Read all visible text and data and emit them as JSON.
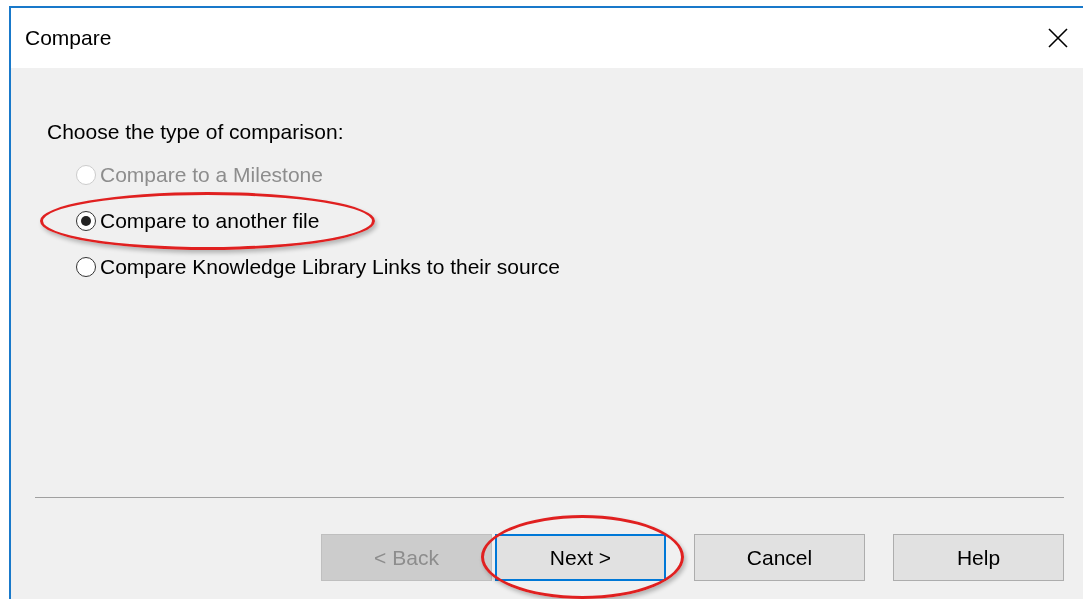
{
  "window": {
    "title": "Compare"
  },
  "prompt": "Choose the type of comparison:",
  "options": [
    {
      "label": "Compare to a Milestone",
      "selected": false,
      "disabled": true,
      "highlighted": false
    },
    {
      "label": "Compare to another file",
      "selected": true,
      "disabled": false,
      "highlighted": true
    },
    {
      "label": "Compare Knowledge Library Links to their source",
      "selected": false,
      "disabled": false,
      "highlighted": false
    }
  ],
  "buttons": [
    {
      "label": "< Back",
      "disabled": true,
      "focused": false,
      "highlighted": false
    },
    {
      "label": "Next >",
      "disabled": false,
      "focused": true,
      "highlighted": true
    },
    {
      "label": "Cancel",
      "disabled": false,
      "focused": false,
      "highlighted": false
    },
    {
      "label": "Help",
      "disabled": false,
      "focused": false,
      "highlighted": false
    }
  ]
}
